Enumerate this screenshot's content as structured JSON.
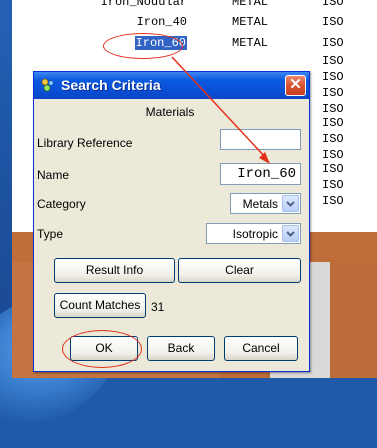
{
  "background": {
    "materials": [
      {
        "name": "Iron_Nodular",
        "type": "METAL",
        "code": "ISO"
      },
      {
        "name": "Iron_40",
        "type": "METAL",
        "code": "ISO"
      },
      {
        "name": "Iron_60",
        "type": "METAL",
        "code": "ISO",
        "selected": true
      },
      {
        "name": "",
        "type": "",
        "code": "ISO"
      },
      {
        "name": "",
        "type": "",
        "code": "ISO"
      },
      {
        "name": "",
        "type": "",
        "code": "ISO"
      },
      {
        "name": "",
        "type": "",
        "code": "ISO"
      },
      {
        "name": "",
        "type": "",
        "code": "ISO"
      },
      {
        "name": "",
        "type": "",
        "code": "ISO"
      },
      {
        "name": "",
        "type": "",
        "code": "ISO"
      },
      {
        "name": "",
        "type": "",
        "code": "ISO"
      },
      {
        "name": "",
        "type": "",
        "code": "ISO"
      },
      {
        "name": "",
        "type": "",
        "code": "ISO"
      }
    ]
  },
  "dialog": {
    "title": "Search Criteria",
    "title_icon": "search-criteria-icon",
    "close_icon": "close-icon",
    "section_label": "Materials",
    "library_reference": {
      "label": "Library Reference",
      "value": ""
    },
    "name": {
      "label": "Name",
      "value": "Iron_60"
    },
    "category": {
      "label": "Category",
      "selected": "Metals"
    },
    "type": {
      "label": "Type",
      "selected": "Isotropic"
    },
    "buttons": {
      "result_info": "Result Info",
      "clear": "Clear",
      "count_matches": "Count Matches",
      "ok": "OK",
      "back": "Back",
      "cancel": "Cancel"
    },
    "match_count": "31"
  },
  "colors": {
    "selection": "#3163c5",
    "annotation": "#e5301c",
    "title_bar": "#0a4fd6",
    "close_button": "#d8522e",
    "dialog_face": "#ece9d8"
  }
}
